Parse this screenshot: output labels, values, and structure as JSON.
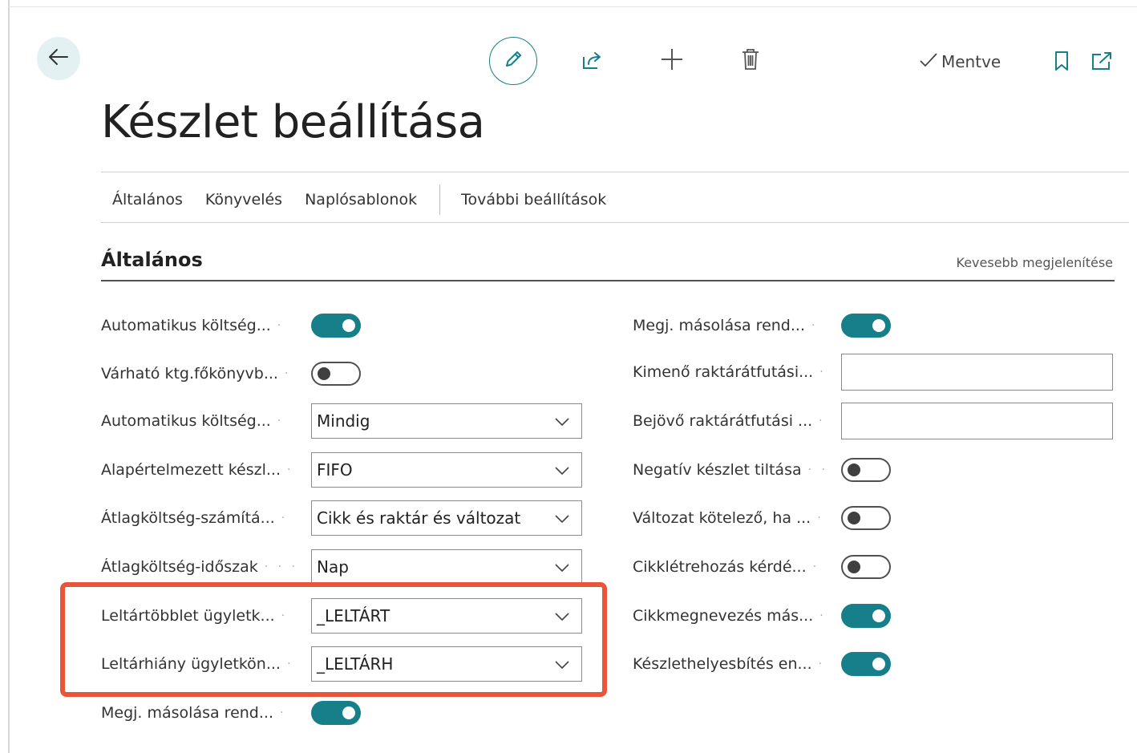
{
  "toolbar": {
    "saved_label": "Mentve"
  },
  "page": {
    "title": "Készlet beállítása"
  },
  "tabs": [
    {
      "label": "Általános"
    },
    {
      "label": "Könyvelés"
    },
    {
      "label": "Naplósablonok"
    },
    {
      "label": "További beállítások"
    }
  ],
  "section": {
    "title": "Általános",
    "toggle_link": "Kevesebb megjelenítése"
  },
  "left_fields": [
    {
      "label": "Automatikus költség...",
      "type": "toggle",
      "value": true
    },
    {
      "label": "Várható ktg.főkönyvb...",
      "type": "toggle",
      "value": false
    },
    {
      "label": "Automatikus költség...",
      "type": "select",
      "value": "Mindig"
    },
    {
      "label": "Alapértelmezett készl...",
      "type": "select",
      "value": "FIFO"
    },
    {
      "label": "Átlagköltség-számítá...",
      "type": "select",
      "value": "Cikk és raktár és változat"
    },
    {
      "label": "Átlagköltség-időszak",
      "type": "select",
      "value": "Nap"
    },
    {
      "label": "Leltártöbblet ügyletk...",
      "type": "select",
      "value": "_LELTÁRT"
    },
    {
      "label": "Leltárhiány ügyletkön...",
      "type": "select",
      "value": "_LELTÁRH"
    },
    {
      "label": "Megj. másolása rend...",
      "type": "toggle",
      "value": true
    }
  ],
  "right_fields": [
    {
      "label": "Megj. másolása rend...",
      "type": "toggle",
      "value": true
    },
    {
      "label": "Kimenő raktárátfutási...",
      "type": "text",
      "value": ""
    },
    {
      "label": "Bejövő raktárátfutási ...",
      "type": "text",
      "value": ""
    },
    {
      "label": "Negatív készlet tiltása",
      "type": "toggle",
      "value": false
    },
    {
      "label": "Változat kötelező, ha ...",
      "type": "toggle",
      "value": false
    },
    {
      "label": "Cikklétrehozás kérdé...",
      "type": "toggle",
      "value": false
    },
    {
      "label": "Cikkmegnevezés más...",
      "type": "toggle",
      "value": true
    },
    {
      "label": "Készlethelyesbítés en...",
      "type": "toggle",
      "value": true
    }
  ],
  "colors": {
    "accent": "#167f89",
    "highlight": "#e8553b",
    "back_button_bg": "#e3f1f3"
  },
  "icons": [
    "back-arrow-icon",
    "pencil-icon",
    "share-icon",
    "plus-icon",
    "trash-icon",
    "checkmark-icon",
    "bookmark-icon",
    "open-new-window-icon",
    "chevron-down-icon"
  ]
}
